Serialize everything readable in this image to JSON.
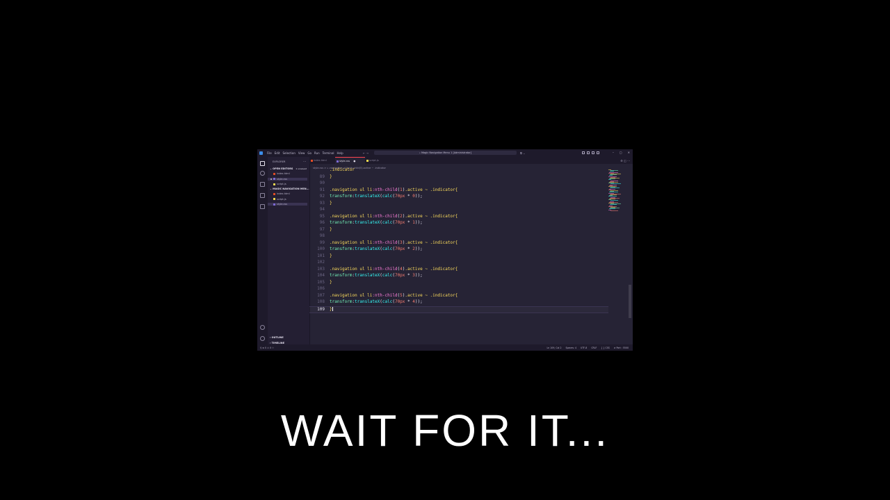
{
  "window": {
    "title": "Magic Navigation Menu 1 [Administrator]",
    "menu": [
      "File",
      "Edit",
      "Selection",
      "View",
      "Go",
      "Run",
      "Terminal",
      "Help"
    ],
    "nav_arrows": "← →",
    "copilot": "⧉ ⌄",
    "controls": [
      "–",
      "▢",
      "✕"
    ]
  },
  "sidebar": {
    "title": "EXPLORER",
    "more": "···",
    "open_editors_label": "OPEN EDITORS",
    "unsaved_label": "1 unsaved",
    "open_editors": [
      {
        "name": "index.html",
        "color": "#e44d26",
        "modified": false,
        "selected": false
      },
      {
        "name": "style.css",
        "color": "#7e6ad6",
        "modified": true,
        "selected": true
      },
      {
        "name": "script.js",
        "color": "#f0db4f",
        "modified": false,
        "selected": false
      }
    ],
    "folder_label": "MAGIC NAVIGATION MEN...",
    "folder_files": [
      {
        "name": "index.html",
        "color": "#e44d26",
        "selected": false
      },
      {
        "name": "script.js",
        "color": "#f0db4f",
        "selected": false
      },
      {
        "name": "style.css",
        "color": "#7e6ad6",
        "selected": true
      }
    ],
    "outline_label": "OUTLINE",
    "timeline_label": "TIMELINE"
  },
  "tabs": [
    {
      "name": "index.html",
      "color": "#e44d26",
      "active": false
    },
    {
      "name": "style.css",
      "color": "#7e6ad6",
      "active": true,
      "dirty": "●"
    },
    {
      "name": "script.js",
      "color": "#f0db4f",
      "active": false
    }
  ],
  "tab_actions": "⚙ ◫ ···",
  "breadcrumb": "style.css > ⁎ .navigation ul li:nth-child(5).active ~ .indicator",
  "code_lines": [
    {
      "num": "",
      "tokens": [
        {
          "t": ".indicator",
          "c": "c-sel"
        }
      ]
    },
    {
      "num": "89",
      "tokens": [
        {
          "t": "}",
          "c": "c-br"
        }
      ]
    },
    {
      "num": "90",
      "tokens": []
    },
    {
      "num": "91",
      "tokens": [
        {
          "t": ".navigation ul li",
          "c": "c-sel"
        },
        {
          "t": ":nth-child",
          "c": "c-ps"
        },
        {
          "t": "(",
          "c": "c-punc"
        },
        {
          "t": "1",
          "c": "c-num"
        },
        {
          "t": ")",
          "c": "c-punc"
        },
        {
          "t": ".active ~ .indicator",
          "c": "c-sel"
        },
        {
          "t": "{",
          "c": "c-br"
        }
      ]
    },
    {
      "num": "92",
      "tokens": [
        {
          "t": "transform",
          "c": "c-prop"
        },
        {
          "t": ":",
          "c": "c-punc"
        },
        {
          "t": "translateX",
          "c": "c-fn"
        },
        {
          "t": "(",
          "c": "c-punc"
        },
        {
          "t": "calc",
          "c": "c-fn"
        },
        {
          "t": "(",
          "c": "c-punc"
        },
        {
          "t": "70px",
          "c": "c-num"
        },
        {
          "t": " * ",
          "c": "c-punc"
        },
        {
          "t": "0",
          "c": "c-num"
        },
        {
          "t": "));",
          "c": "c-punc"
        }
      ]
    },
    {
      "num": "93",
      "tokens": [
        {
          "t": "}",
          "c": "c-br"
        }
      ]
    },
    {
      "num": "94",
      "tokens": []
    },
    {
      "num": "95",
      "tokens": [
        {
          "t": ".navigation ul li",
          "c": "c-sel"
        },
        {
          "t": ":nth-child",
          "c": "c-ps"
        },
        {
          "t": "(",
          "c": "c-punc"
        },
        {
          "t": "2",
          "c": "c-num"
        },
        {
          "t": ")",
          "c": "c-punc"
        },
        {
          "t": ".active ~ .indicator",
          "c": "c-sel"
        },
        {
          "t": "{",
          "c": "c-br"
        }
      ]
    },
    {
      "num": "96",
      "tokens": [
        {
          "t": "transform",
          "c": "c-prop"
        },
        {
          "t": ":",
          "c": "c-punc"
        },
        {
          "t": "translateX",
          "c": "c-fn"
        },
        {
          "t": "(",
          "c": "c-punc"
        },
        {
          "t": "calc",
          "c": "c-fn"
        },
        {
          "t": "(",
          "c": "c-punc"
        },
        {
          "t": "70px",
          "c": "c-num"
        },
        {
          "t": " * ",
          "c": "c-punc"
        },
        {
          "t": "1",
          "c": "c-num"
        },
        {
          "t": "));",
          "c": "c-punc"
        }
      ]
    },
    {
      "num": "97",
      "tokens": [
        {
          "t": "}",
          "c": "c-br"
        }
      ]
    },
    {
      "num": "98",
      "tokens": []
    },
    {
      "num": "99",
      "tokens": [
        {
          "t": ".navigation ul li",
          "c": "c-sel"
        },
        {
          "t": ":nth-child",
          "c": "c-ps"
        },
        {
          "t": "(",
          "c": "c-punc"
        },
        {
          "t": "3",
          "c": "c-num"
        },
        {
          "t": ")",
          "c": "c-punc"
        },
        {
          "t": ".active ~ .indicator",
          "c": "c-sel"
        },
        {
          "t": "{",
          "c": "c-br"
        }
      ]
    },
    {
      "num": "100",
      "tokens": [
        {
          "t": "transform",
          "c": "c-prop"
        },
        {
          "t": ":",
          "c": "c-punc"
        },
        {
          "t": "translateX",
          "c": "c-fn"
        },
        {
          "t": "(",
          "c": "c-punc"
        },
        {
          "t": "calc",
          "c": "c-fn"
        },
        {
          "t": "(",
          "c": "c-punc"
        },
        {
          "t": "70px",
          "c": "c-num"
        },
        {
          "t": " * ",
          "c": "c-punc"
        },
        {
          "t": "2",
          "c": "c-num"
        },
        {
          "t": "));",
          "c": "c-punc"
        }
      ]
    },
    {
      "num": "101",
      "tokens": [
        {
          "t": "}",
          "c": "c-br"
        }
      ]
    },
    {
      "num": "102",
      "tokens": []
    },
    {
      "num": "103",
      "tokens": [
        {
          "t": ".navigation ul li",
          "c": "c-sel"
        },
        {
          "t": ":nth-child",
          "c": "c-ps"
        },
        {
          "t": "(",
          "c": "c-punc"
        },
        {
          "t": "4",
          "c": "c-num"
        },
        {
          "t": ")",
          "c": "c-punc"
        },
        {
          "t": ".active ~ .indicator",
          "c": "c-sel"
        },
        {
          "t": "{",
          "c": "c-br"
        }
      ]
    },
    {
      "num": "104",
      "tokens": [
        {
          "t": "transform",
          "c": "c-prop"
        },
        {
          "t": ":",
          "c": "c-punc"
        },
        {
          "t": "translateX",
          "c": "c-fn"
        },
        {
          "t": "(",
          "c": "c-punc"
        },
        {
          "t": "calc",
          "c": "c-fn"
        },
        {
          "t": "(",
          "c": "c-punc"
        },
        {
          "t": "70px",
          "c": "c-num"
        },
        {
          "t": " * ",
          "c": "c-punc"
        },
        {
          "t": "3",
          "c": "c-num"
        },
        {
          "t": "));",
          "c": "c-punc"
        }
      ]
    },
    {
      "num": "105",
      "tokens": [
        {
          "t": "}",
          "c": "c-br"
        }
      ]
    },
    {
      "num": "106",
      "tokens": []
    },
    {
      "num": "107",
      "tokens": [
        {
          "t": ".navigation ul li",
          "c": "c-sel"
        },
        {
          "t": ":nth-child",
          "c": "c-ps"
        },
        {
          "t": "(",
          "c": "c-punc"
        },
        {
          "t": "5",
          "c": "c-num"
        },
        {
          "t": ")",
          "c": "c-punc"
        },
        {
          "t": ".active ~ .indicator",
          "c": "c-sel"
        },
        {
          "t": "{",
          "c": "c-br"
        }
      ]
    },
    {
      "num": "108",
      "tokens": [
        {
          "t": "transform",
          "c": "c-prop"
        },
        {
          "t": ":",
          "c": "c-punc"
        },
        {
          "t": "translateX",
          "c": "c-fn"
        },
        {
          "t": "(",
          "c": "c-punc"
        },
        {
          "t": "calc",
          "c": "c-fn"
        },
        {
          "t": "(",
          "c": "c-punc"
        },
        {
          "t": "70px",
          "c": "c-num"
        },
        {
          "t": " * ",
          "c": "c-punc"
        },
        {
          "t": "4",
          "c": "c-num"
        },
        {
          "t": "));",
          "c": "c-punc"
        }
      ]
    },
    {
      "num": "109",
      "tokens": [
        {
          "t": "}",
          "c": "c-br"
        }
      ],
      "current": true
    }
  ],
  "statusbar": {
    "left": "⚲  ⊗ 0 ⚠ 0   ⚇",
    "right": [
      "Ln 109, Col 2",
      "Spaces: 4",
      "UTF-8",
      "CRLF",
      "{ } CSS",
      "⊘ Port : 5500"
    ]
  },
  "caption": "WAIT FOR IT..."
}
